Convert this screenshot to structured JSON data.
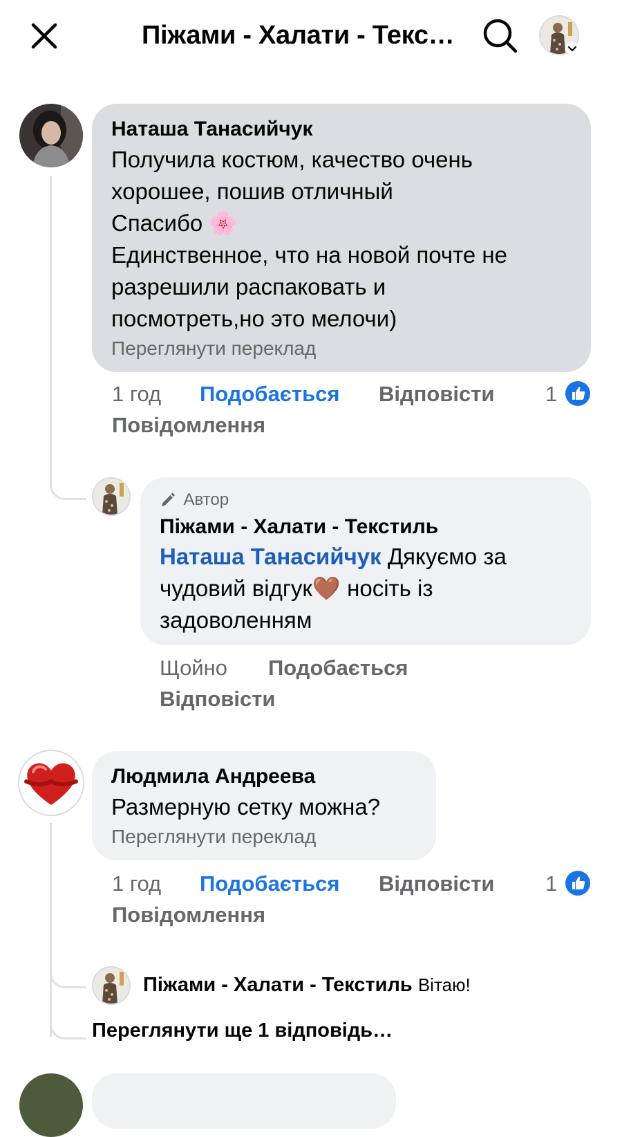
{
  "header": {
    "close_icon": "close-icon",
    "title": "Піжами - Халати - Текс…",
    "search_icon": "search-icon",
    "profile_icon": "chevron-down-icon"
  },
  "comments": [
    {
      "author": "Наташа Танасийчук",
      "lines": [
        "Получила костюм, качество очень",
        "хорошее, пошив отличный",
        "Спасибо 🌸",
        "Единственное, что на новой почте не",
        "разрешили распаковать и",
        "посмотреть,но это мелочи)"
      ],
      "translate": "Переглянути переклад",
      "time": "1 год",
      "like": "Подобається",
      "reply": "Відповісти",
      "message": "Повідомлення",
      "like_count": "1",
      "reply_item": {
        "badge": "Автор",
        "author": "Піжами - Халати - Текстиль",
        "mention": "Наташа Танасийчук",
        "line1_rest": " Дякуємо за",
        "line2": "чудовий відгук🤎 носіть із",
        "line3": "задоволенням",
        "time": "Щойно",
        "like": "Подобається",
        "reply": "Відповісти"
      }
    },
    {
      "author": "Людмила Андреева",
      "lines": [
        "Размерную сетку можна?"
      ],
      "translate": "Переглянути переклад",
      "time": "1 год",
      "like": "Подобається",
      "reply": "Відповісти",
      "message": "Повідомлення",
      "like_count": "1",
      "reply_item": {
        "author": "Піжами - Халати - Текстиль",
        "text": "Вітаю!"
      },
      "more_replies": "Переглянути ще 1 відповідь…"
    }
  ],
  "colors": {
    "accent": "#1b74e4",
    "mention": "#1b5fb8",
    "muted": "#65676b"
  }
}
